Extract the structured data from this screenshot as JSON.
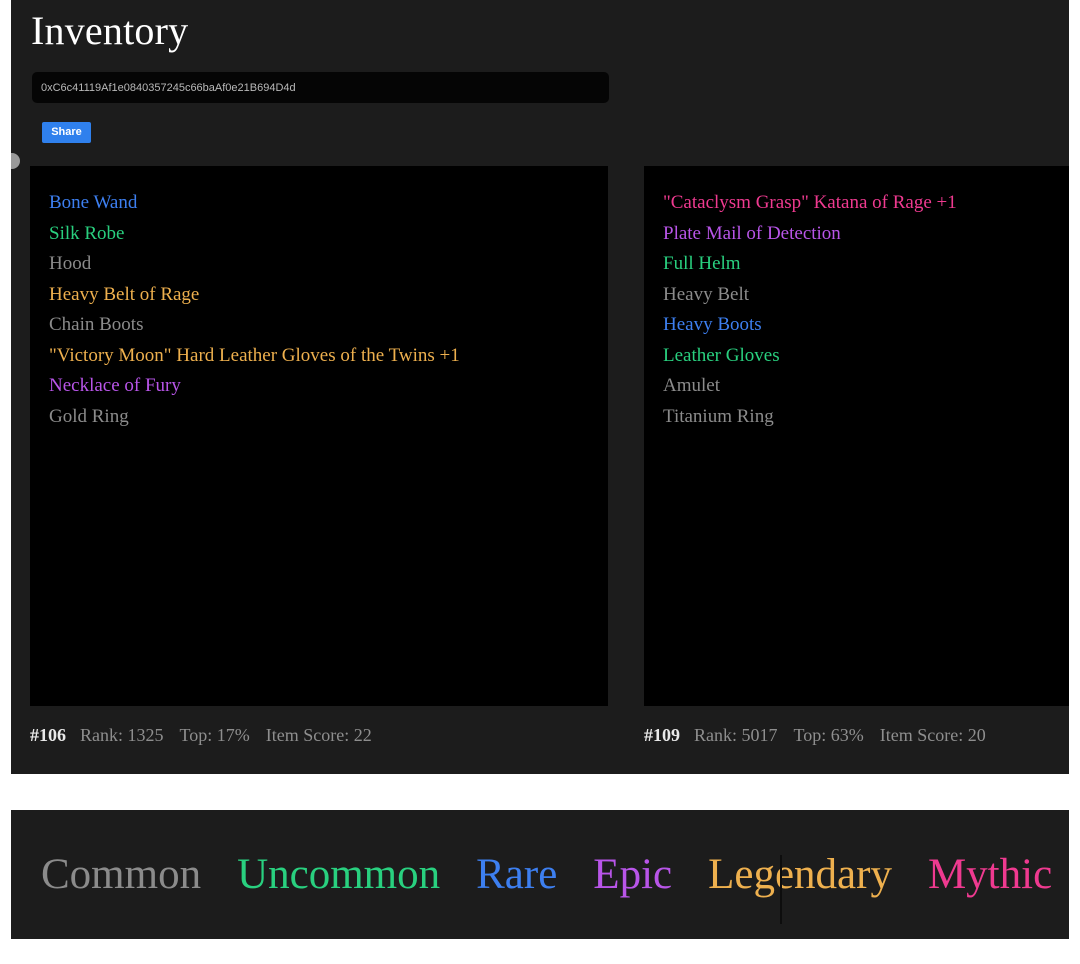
{
  "page": {
    "title": "Inventory",
    "background": "#ffffff",
    "panel_background": "#1c1c1c",
    "card_background": "#000000"
  },
  "address": {
    "value": "0xC6c41119Af1e0840357245c66baAf0e21B694D4d",
    "placeholder": "0x..."
  },
  "share": {
    "label": "Share",
    "color": "#2f80ed"
  },
  "rarity_colors": {
    "common": "#8b8b8b",
    "uncommon": "#29d07f",
    "rare": "#3d7ff0",
    "epic": "#b855e8",
    "legendary": "#eeb04e",
    "mythic": "#ef3a90"
  },
  "bags": [
    {
      "id": "#106",
      "rank_label": "Rank: 1325",
      "top_label": "Top: 17%",
      "score_label": "Item Score: 22",
      "items": [
        {
          "name": "Bone Wand",
          "rarity": "rare",
          "color": "#3d7ff0"
        },
        {
          "name": "Silk Robe",
          "rarity": "uncommon",
          "color": "#29d07f"
        },
        {
          "name": "Hood",
          "rarity": "common",
          "color": "#8b8b8b"
        },
        {
          "name": "Heavy Belt of Rage",
          "rarity": "legendary",
          "color": "#eeb04e"
        },
        {
          "name": "Chain Boots",
          "rarity": "common",
          "color": "#8b8b8b"
        },
        {
          "name": "\"Victory Moon\" Hard Leather Gloves of the Twins +1",
          "rarity": "legendary",
          "color": "#eeb04e"
        },
        {
          "name": "Necklace of Fury",
          "rarity": "epic",
          "color": "#b855e8"
        },
        {
          "name": "Gold Ring",
          "rarity": "common",
          "color": "#8b8b8b"
        }
      ]
    },
    {
      "id": "#109",
      "rank_label": "Rank: 5017",
      "top_label": "Top: 63%",
      "score_label": "Item Score: 20",
      "items": [
        {
          "name": "\"Cataclysm Grasp\" Katana of Rage +1",
          "rarity": "mythic",
          "color": "#ef3a90"
        },
        {
          "name": "Plate Mail of Detection",
          "rarity": "epic",
          "color": "#b855e8"
        },
        {
          "name": "Full Helm",
          "rarity": "uncommon",
          "color": "#29d07f"
        },
        {
          "name": "Heavy Belt",
          "rarity": "common",
          "color": "#8b8b8b"
        },
        {
          "name": "Heavy Boots",
          "rarity": "rare",
          "color": "#3d7ff0"
        },
        {
          "name": "Leather Gloves",
          "rarity": "uncommon",
          "color": "#29d07f"
        },
        {
          "name": "Amulet",
          "rarity": "common",
          "color": "#8b8b8b"
        },
        {
          "name": "Titanium Ring",
          "rarity": "common",
          "color": "#8b8b8b"
        }
      ]
    }
  ],
  "legend": {
    "items": [
      {
        "label": "Common",
        "color": "#8b8b8b"
      },
      {
        "label": "Uncommon",
        "color": "#29d07f"
      },
      {
        "label": "Rare",
        "color": "#3d7ff0"
      },
      {
        "label": "Epic",
        "color": "#b855e8"
      },
      {
        "label": "Legendary",
        "color": "#eeb04e"
      },
      {
        "label": "Mythic",
        "color": "#ef3a90"
      }
    ]
  }
}
